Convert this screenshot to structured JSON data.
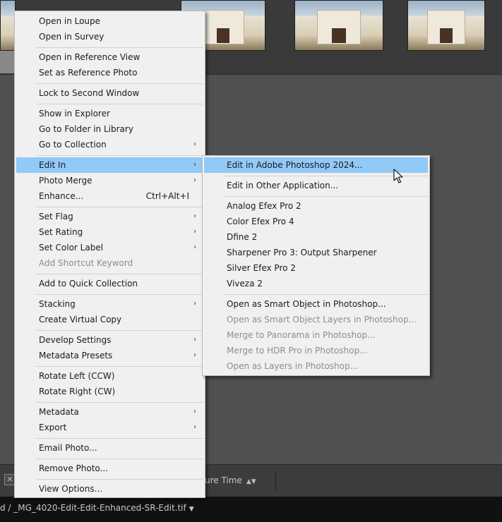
{
  "background": {
    "toolbar": {
      "sort_label": "ure Time",
      "sort_arrows": "▲▼"
    },
    "statusbar": {
      "path": "d  / _MG_4020-Edit-Edit-Enhanced-SR-Edit.tif",
      "caret": "▼"
    }
  },
  "main_menu": {
    "items": [
      {
        "label": "Open in Loupe"
      },
      {
        "label": "Open in Survey"
      },
      {
        "label": "Open in Reference View"
      },
      {
        "label": "Set as Reference Photo"
      },
      {
        "label": "Lock to Second Window"
      },
      {
        "label": "Show in Explorer"
      },
      {
        "label": "Go to Folder in Library"
      },
      {
        "label": "Go to Collection",
        "arrow": "›"
      },
      {
        "label": "Edit In",
        "arrow": "›"
      },
      {
        "label": "Photo Merge",
        "arrow": "›"
      },
      {
        "label": "Enhance...",
        "shortcut": "Ctrl+Alt+I"
      },
      {
        "label": "Set Flag",
        "arrow": "›"
      },
      {
        "label": "Set Rating",
        "arrow": "›"
      },
      {
        "label": "Set Color Label",
        "arrow": "›"
      },
      {
        "label": "Add Shortcut Keyword"
      },
      {
        "label": "Add to Quick Collection"
      },
      {
        "label": "Stacking",
        "arrow": "›"
      },
      {
        "label": "Create Virtual Copy"
      },
      {
        "label": "Develop Settings",
        "arrow": "›"
      },
      {
        "label": "Metadata Presets",
        "arrow": "›"
      },
      {
        "label": "Rotate Left (CCW)"
      },
      {
        "label": "Rotate Right (CW)"
      },
      {
        "label": "Metadata",
        "arrow": "›"
      },
      {
        "label": "Export",
        "arrow": "›"
      },
      {
        "label": "Email Photo..."
      },
      {
        "label": "Remove Photo..."
      },
      {
        "label": "View Options..."
      }
    ]
  },
  "submenu": {
    "items": [
      {
        "label": "Edit in Adobe Photoshop 2024..."
      },
      {
        "label": "Edit in Other Application..."
      },
      {
        "label": "Analog Efex Pro 2"
      },
      {
        "label": "Color Efex Pro 4"
      },
      {
        "label": "Dfine 2"
      },
      {
        "label": "Sharpener Pro 3: Output Sharpener"
      },
      {
        "label": "Silver Efex Pro 2"
      },
      {
        "label": "Viveza 2"
      },
      {
        "label": "Open as Smart Object in Photoshop..."
      },
      {
        "label": "Open as Smart Object Layers in Photoshop..."
      },
      {
        "label": "Merge to Panorama in Photoshop..."
      },
      {
        "label": "Merge to HDR Pro in Photoshop..."
      },
      {
        "label": "Open as Layers in Photoshop..."
      }
    ]
  },
  "colors": {
    "menu_bg": "#f0f0f0",
    "highlight": "#91c9f7",
    "disabled_text": "#8d8d8d"
  },
  "close_glyph": "✕"
}
